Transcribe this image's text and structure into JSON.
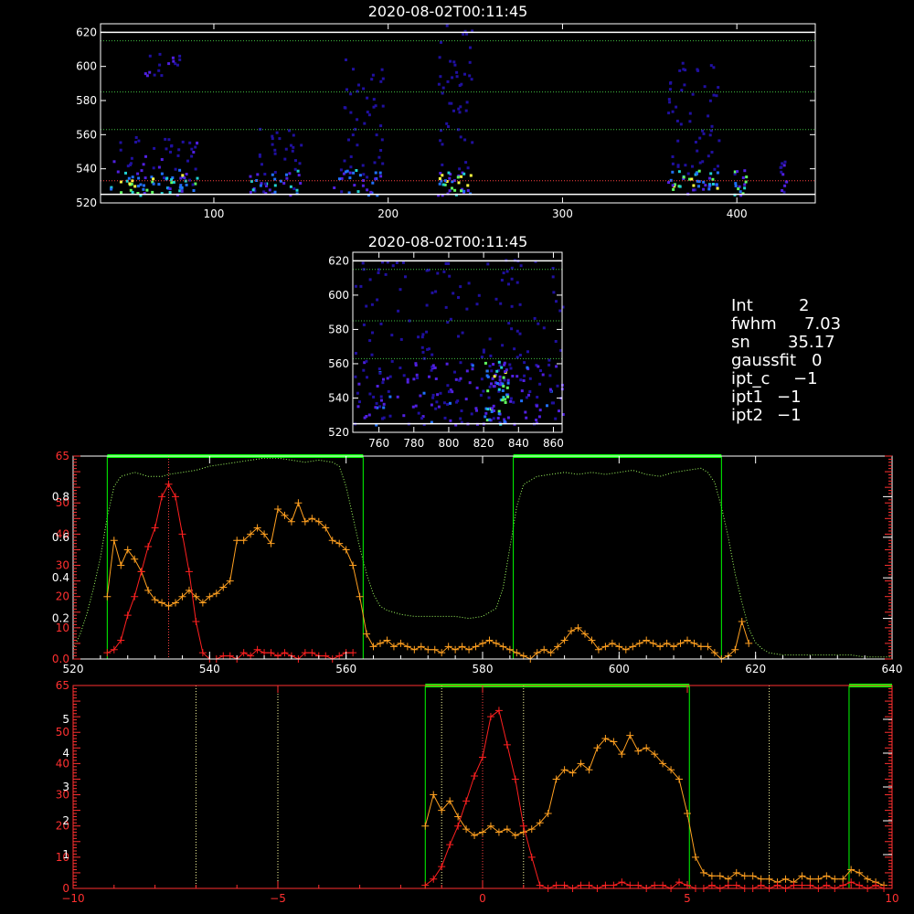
{
  "colors": {
    "background": "#000000",
    "axes": "#ffffff",
    "red_series": "#ff2020",
    "orange_series": "#ffa020",
    "green_curve": "#a0ff60",
    "green_window": "#00ff00",
    "dotted_white": "#ffffa0",
    "dotted_red": "#ff4040",
    "dotted_green": "#40c040"
  },
  "info_panel": {
    "labels": [
      "Int",
      "fwhm",
      "sn",
      "gaussfit",
      "ipt_c",
      "ipt1",
      "ipt2"
    ],
    "values": [
      "2",
      "7.03",
      "35.17",
      "0",
      "−1",
      "−1",
      "−1"
    ]
  },
  "chart_data": [
    {
      "type": "heatmap",
      "title": "2020-08-02T00:11:45",
      "xlim": [
        35,
        445
      ],
      "ylim": [
        520,
        625
      ],
      "xticks": [
        "100",
        "200",
        "300",
        "400"
      ],
      "yticks": [
        "520",
        "540",
        "560",
        "580",
        "600",
        "620"
      ],
      "hlines_white": [
        525,
        620
      ],
      "hlines_green_dotted": [
        563,
        585,
        615
      ],
      "hlines_red_dotted": [
        533
      ],
      "clusters": [
        {
          "x0": 40,
          "x1": 90,
          "y0": 525,
          "y1": 540,
          "level": 0.9
        },
        {
          "x0": 40,
          "x1": 90,
          "y0": 540,
          "y1": 560,
          "level": 0.3
        },
        {
          "x0": 60,
          "x1": 80,
          "y0": 595,
          "y1": 610,
          "level": 0.3
        },
        {
          "x0": 120,
          "x1": 150,
          "y0": 525,
          "y1": 540,
          "level": 0.7
        },
        {
          "x0": 125,
          "x1": 150,
          "y0": 540,
          "y1": 565,
          "level": 0.25
        },
        {
          "x0": 168,
          "x1": 195,
          "y0": 525,
          "y1": 540,
          "level": 0.6
        },
        {
          "x0": 172,
          "x1": 198,
          "y0": 540,
          "y1": 610,
          "level": 0.2
        },
        {
          "x0": 228,
          "x1": 248,
          "y0": 525,
          "y1": 540,
          "level": 1.0
        },
        {
          "x0": 228,
          "x1": 248,
          "y0": 540,
          "y1": 625,
          "level": 0.25
        },
        {
          "x0": 360,
          "x1": 390,
          "y0": 525,
          "y1": 540,
          "level": 0.9
        },
        {
          "x0": 360,
          "x1": 390,
          "y0": 540,
          "y1": 605,
          "level": 0.25
        },
        {
          "x0": 397,
          "x1": 405,
          "y0": 525,
          "y1": 540,
          "level": 0.8
        },
        {
          "x0": 424,
          "x1": 430,
          "y0": 525,
          "y1": 545,
          "level": 0.4
        }
      ]
    },
    {
      "type": "heatmap",
      "title": "2020-08-02T00:11:45",
      "xlim": [
        745,
        865
      ],
      "ylim": [
        520,
        625
      ],
      "xticks": [
        "760",
        "780",
        "800",
        "820",
        "840",
        "860"
      ],
      "yticks": [
        "520",
        "540",
        "560",
        "580",
        "600",
        "620"
      ],
      "hlines_white": [
        525,
        620
      ],
      "hlines_green_dotted": [
        563,
        585,
        615
      ],
      "clusters": [
        {
          "x0": 745,
          "x1": 865,
          "y0": 525,
          "y1": 562,
          "level": 0.45
        },
        {
          "x0": 820,
          "x1": 835,
          "y0": 525,
          "y1": 562,
          "level": 0.9
        },
        {
          "x0": 745,
          "x1": 865,
          "y0": 562,
          "y1": 622,
          "level": 0.15
        }
      ]
    },
    {
      "type": "line",
      "xlim": [
        520,
        640
      ],
      "ylim_left": [
        0,
        65
      ],
      "ylim_right": [
        0,
        1
      ],
      "xticks": [
        "520",
        "540",
        "560",
        "580",
        "600",
        "620",
        "640"
      ],
      "yticks_red": [
        "0.0",
        "10",
        "20",
        "30",
        "40",
        "50",
        "65"
      ],
      "yticks_white": [
        "0.2",
        "0.4",
        "0.6",
        "0.8"
      ],
      "green_windows": [
        [
          525,
          562.5
        ],
        [
          584.5,
          615
        ]
      ],
      "vline_red_dotted": 534,
      "red_series": {
        "x": [
          525,
          526,
          527,
          528,
          529,
          530,
          531,
          532,
          533,
          534,
          535,
          536,
          537,
          538,
          539,
          540,
          541,
          542,
          543,
          544,
          545,
          546,
          547,
          548,
          549,
          550,
          551,
          552,
          553,
          554,
          555,
          556,
          557,
          558,
          559,
          560,
          561
        ],
        "y": [
          2,
          3,
          6,
          14,
          20,
          28,
          36,
          42,
          52,
          56,
          52,
          40,
          28,
          12,
          2,
          0,
          0,
          1,
          1,
          0,
          2,
          1,
          3,
          2,
          2,
          1,
          2,
          1,
          0,
          2,
          2,
          1,
          1,
          0,
          1,
          2,
          2
        ]
      },
      "orange_series": {
        "x": [
          525,
          526,
          527,
          528,
          529,
          530,
          531,
          532,
          533,
          534,
          535,
          536,
          537,
          538,
          539,
          540,
          541,
          542,
          543,
          544,
          545,
          546,
          547,
          548,
          549,
          550,
          551,
          552,
          553,
          554,
          555,
          556,
          557,
          558,
          559,
          560,
          561,
          562,
          563,
          564,
          565,
          566,
          567,
          568,
          569,
          570,
          571,
          572,
          573,
          574,
          575,
          576,
          577,
          578,
          579,
          580,
          581,
          582,
          583,
          584,
          585,
          586,
          587,
          588,
          589,
          590,
          591,
          592,
          593,
          594,
          595,
          596,
          597,
          598,
          599,
          600,
          601,
          602,
          603,
          604,
          605,
          606,
          607,
          608,
          609,
          610,
          611,
          612,
          613,
          614,
          615,
          616,
          617,
          618,
          619
        ],
        "y": [
          20,
          38,
          30,
          35,
          32,
          28,
          22,
          19,
          18,
          17,
          18,
          20,
          22,
          20,
          18,
          20,
          21,
          23,
          25,
          38,
          38,
          40,
          42,
          40,
          37,
          48,
          46,
          44,
          50,
          44,
          45,
          44,
          42,
          38,
          37,
          35,
          30,
          20,
          8,
          4,
          5,
          6,
          4,
          5,
          4,
          3,
          4,
          3,
          3,
          2,
          4,
          3,
          4,
          3,
          4,
          5,
          6,
          5,
          4,
          3,
          2,
          1,
          0,
          2,
          3,
          2,
          4,
          6,
          9,
          10,
          8,
          6,
          3,
          4,
          5,
          4,
          3,
          4,
          5,
          6,
          5,
          4,
          5,
          4,
          5,
          6,
          5,
          4,
          4,
          2,
          0,
          1,
          3,
          12,
          5
        ]
      },
      "green_curve": {
        "x": [
          520,
          521,
          522,
          523,
          524,
          525,
          526,
          527,
          528,
          529,
          530,
          531,
          532,
          533,
          534,
          536,
          538,
          540,
          542,
          544,
          546,
          548,
          550,
          552,
          554,
          556,
          558,
          559,
          560,
          561,
          562,
          563,
          564,
          565,
          566,
          568,
          570,
          572,
          574,
          576,
          578,
          580,
          582,
          583,
          584,
          585,
          586,
          588,
          590,
          592,
          594,
          596,
          598,
          600,
          602,
          604,
          606,
          608,
          610,
          612,
          613,
          614,
          615,
          616,
          617,
          618,
          619,
          620,
          621,
          622,
          624,
          626,
          628,
          630,
          632,
          634,
          636,
          638,
          640
        ],
        "y": [
          0.05,
          0.12,
          0.22,
          0.35,
          0.5,
          0.7,
          0.85,
          0.9,
          0.91,
          0.92,
          0.91,
          0.9,
          0.9,
          0.9,
          0.91,
          0.92,
          0.93,
          0.95,
          0.96,
          0.97,
          0.98,
          0.99,
          0.99,
          0.98,
          0.97,
          0.98,
          0.97,
          0.95,
          0.85,
          0.7,
          0.55,
          0.42,
          0.32,
          0.26,
          0.24,
          0.22,
          0.21,
          0.21,
          0.21,
          0.21,
          0.2,
          0.21,
          0.25,
          0.35,
          0.55,
          0.75,
          0.86,
          0.9,
          0.91,
          0.92,
          0.91,
          0.92,
          0.91,
          0.92,
          0.93,
          0.91,
          0.9,
          0.92,
          0.93,
          0.94,
          0.92,
          0.87,
          0.75,
          0.6,
          0.42,
          0.28,
          0.15,
          0.08,
          0.05,
          0.03,
          0.02,
          0.02,
          0.02,
          0.02,
          0.02,
          0.02,
          0.01,
          0.01,
          0.01
        ]
      }
    },
    {
      "type": "line",
      "xlim": [
        -10,
        10
      ],
      "ylim_left": [
        0,
        65
      ],
      "ylim_right": [
        0,
        6
      ],
      "xticks": [
        "−10",
        "−5",
        "0",
        "5",
        "10"
      ],
      "yticks_red": [
        "0",
        "10",
        "20",
        "30",
        "40",
        "50",
        "65"
      ],
      "yticks_white": [
        "1",
        "2",
        "3",
        "4",
        "5"
      ],
      "green_windows": [
        [
          -1.4,
          5.05
        ],
        [
          8.95,
          10.5
        ]
      ],
      "vlines_white_dotted": [
        -7,
        -5,
        -1,
        1,
        7
      ],
      "vline_red_dotted": 0,
      "red_series": {
        "x": [
          -1.4,
          -1.2,
          -1.0,
          -0.8,
          -0.6,
          -0.4,
          -0.2,
          0.0,
          0.2,
          0.4,
          0.6,
          0.8,
          1.0,
          1.2,
          1.4,
          1.6,
          1.8,
          2.0,
          2.2,
          2.4,
          2.6,
          2.8,
          3.0,
          3.2,
          3.4,
          3.6,
          3.8,
          4.0,
          4.2,
          4.4,
          4.6,
          4.8,
          5.0,
          5.2,
          5.4,
          5.6,
          5.8,
          6.0,
          6.2,
          6.4,
          6.6,
          6.8,
          7.0,
          7.2,
          7.4,
          7.6,
          7.8,
          8.0,
          8.2,
          8.4,
          8.6,
          8.8,
          9.0,
          9.2,
          9.4,
          9.6,
          9.8
        ],
        "y": [
          1,
          3,
          7,
          14,
          20,
          28,
          36,
          42,
          55,
          57,
          46,
          35,
          20,
          10,
          1,
          0,
          1,
          1,
          0,
          1,
          1,
          0,
          1,
          1,
          2,
          1,
          1,
          0,
          1,
          1,
          0,
          2,
          1,
          0,
          0,
          1,
          0,
          1,
          1,
          0,
          0,
          1,
          0,
          1,
          0,
          1,
          1,
          1,
          0,
          1,
          0,
          1,
          2,
          1,
          0,
          1,
          0
        ]
      },
      "orange_series": {
        "x": [
          -1.4,
          -1.2,
          -1.0,
          -0.8,
          -0.6,
          -0.4,
          -0.2,
          0.0,
          0.2,
          0.4,
          0.6,
          0.8,
          1.0,
          1.2,
          1.4,
          1.6,
          1.8,
          2.0,
          2.2,
          2.4,
          2.6,
          2.8,
          3.0,
          3.2,
          3.4,
          3.6,
          3.8,
          4.0,
          4.2,
          4.4,
          4.6,
          4.8,
          5.0,
          5.2,
          5.4,
          5.6,
          5.8,
          6.0,
          6.2,
          6.4,
          6.6,
          6.8,
          7.0,
          7.2,
          7.4,
          7.6,
          7.8,
          8.0,
          8.2,
          8.4,
          8.6,
          8.8,
          9.0,
          9.2,
          9.4,
          9.6,
          9.8
        ],
        "y": [
          20,
          30,
          25,
          28,
          23,
          19,
          17,
          18,
          20,
          18,
          19,
          17,
          18,
          19,
          21,
          24,
          35,
          38,
          37,
          40,
          38,
          45,
          48,
          47,
          43,
          49,
          44,
          45,
          43,
          40,
          38,
          35,
          24,
          10,
          5,
          4,
          4,
          3,
          5,
          4,
          4,
          3,
          3,
          2,
          3,
          2,
          4,
          3,
          3,
          4,
          3,
          3,
          6,
          5,
          3,
          2,
          1
        ]
      }
    }
  ]
}
